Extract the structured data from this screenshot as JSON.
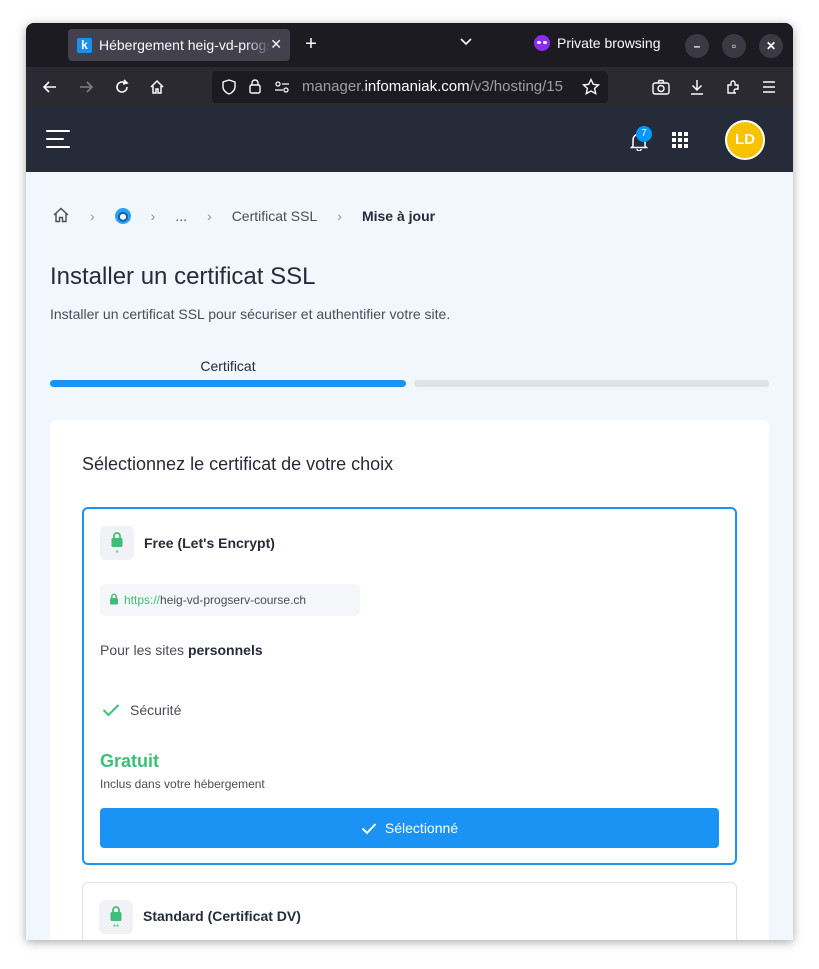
{
  "browser": {
    "tab_title": "Hébergement heig-vd-progserv-course.ch",
    "favicon_letter": "k",
    "private_label": "Private browsing",
    "url_prefix": "manager.",
    "url_host": "infomaniak.com",
    "url_path": "/v3/hosting/15",
    "icons": [
      "back-icon",
      "forward-icon",
      "reload-icon",
      "home-icon",
      "shield-icon",
      "lock-icon",
      "permissions-icon",
      "bookmark-star-icon",
      "screenshot-icon",
      "download-icon",
      "extensions-icon",
      "menu-icon"
    ]
  },
  "header": {
    "notification_count": "7",
    "avatar_initials": "LD",
    "colors": {
      "bar": "#262b3a",
      "avatar": "#f7c300",
      "badge": "#0098ff"
    }
  },
  "breadcrumb": {
    "ellipsis": "...",
    "item_ssl": "Certificat SSL",
    "current": "Mise à jour"
  },
  "page": {
    "title": "Installer un certificat SSL",
    "subtitle": "Installer un certificat SSL pour sécuriser et authentifier votre site.",
    "step_label": "Certificat",
    "step_progress": 0.5
  },
  "certificates": {
    "title": "Sélectionnez le certificat de votre choix",
    "option1": {
      "name": "Free (Let's Encrypt)",
      "stars": "*",
      "url_scheme": "https://",
      "url_domain": "heig-vd-progserv-course.ch",
      "for_prefix": "Pour les sites ",
      "for_bold": "personnels",
      "feature": "Sécurité",
      "price": "Gratuit",
      "price_note": "Inclus dans votre hébergement",
      "button": "Sélectionné",
      "selected": true
    },
    "option2": {
      "name": "Standard (Certificat DV)",
      "stars": "**"
    },
    "colors": {
      "accent": "#1a93f5",
      "green": "#3ebf78"
    }
  }
}
